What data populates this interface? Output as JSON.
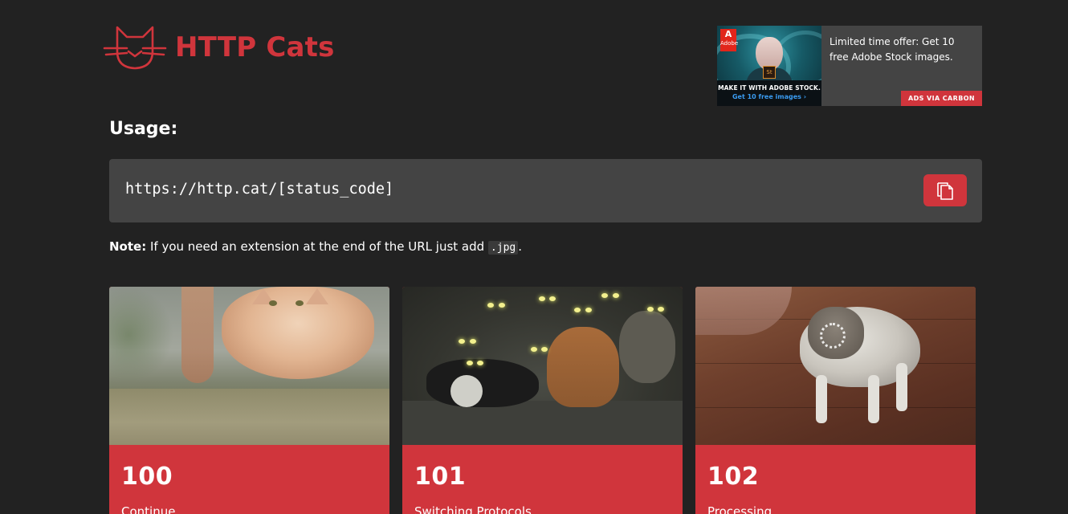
{
  "header": {
    "site_title": "HTTP Cats"
  },
  "ad": {
    "brand_badge": "Adobe",
    "product_badge": "St",
    "image_headline": "MAKE IT WITH ADOBE STOCK.",
    "image_cta": "Get 10 free images ›",
    "text": "Limited time offer: Get 10 free Adobe Stock images.",
    "via_label": "ADS VIA CARBON"
  },
  "usage": {
    "heading": "Usage:",
    "url_template": "https://http.cat/[status_code]",
    "copy_icon": "copy-icon",
    "note_label": "Note:",
    "note_text": " If you need an extension at the end of the URL just add ",
    "note_code": ".jpg",
    "note_end": "."
  },
  "cards": [
    {
      "code": "100",
      "label": "Continue"
    },
    {
      "code": "101",
      "label": "Switching Protocols"
    },
    {
      "code": "102",
      "label": "Processing"
    }
  ],
  "colors": {
    "background": "#222222",
    "accent": "#d0353c",
    "panel": "#444444"
  }
}
